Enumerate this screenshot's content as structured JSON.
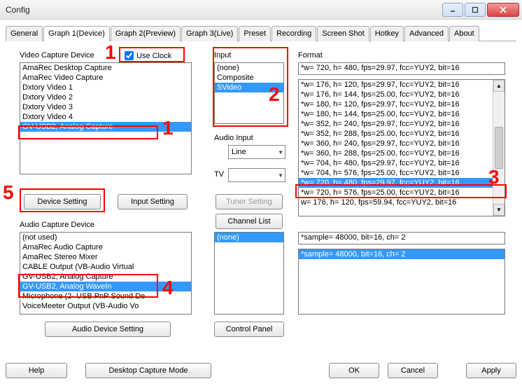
{
  "window": {
    "title": "Config"
  },
  "tabs": [
    "General",
    "Graph 1(Device)",
    "Graph 2(Preview)",
    "Graph 3(Live)",
    "Preset",
    "Recording",
    "Screen Shot",
    "Hotkey",
    "Advanced",
    "About"
  ],
  "active_tab_index": 1,
  "use_clock_label": "Use Clock",
  "use_clock_checked": true,
  "groups": {
    "video_capture": "Video Capture Device",
    "input": "Input",
    "audio_input": "Audio Input",
    "tv": "TV",
    "format": "Format",
    "audio_capture": "Audio Capture Device"
  },
  "video_devices": [
    "AmaRec Desktop Capture",
    "AmaRec Video Capture",
    "Dxtory Video 1",
    "Dxtory Video 2",
    "Dxtory Video 3",
    "Dxtory Video 4",
    "GV-USB2, Analog Capture"
  ],
  "video_devices_selected_index": 6,
  "inputs": [
    "(none)",
    "Composite",
    "SVideo"
  ],
  "inputs_selected_index": 2,
  "audio_input_value": "Line",
  "tv_value": "",
  "format_default": "*w= 720, h= 480, fps=29.97,  fcc=YUY2, bit=16",
  "formats": [
    "*w= 176, h= 120, fps=29.97,  fcc=YUY2, bit=16",
    "*w= 176, h= 144, fps=25.00,  fcc=YUY2, bit=16",
    "*w= 180, h= 120, fps=29.97,  fcc=YUY2, bit=16",
    "*w= 180, h= 144, fps=25.00,  fcc=YUY2, bit=16",
    "*w= 352, h= 240, fps=29.97,  fcc=YUY2, bit=16",
    "*w= 352, h= 288, fps=25.00,  fcc=YUY2, bit=16",
    "*w= 360, h= 240, fps=29.97,  fcc=YUY2, bit=16",
    "*w= 360, h= 288, fps=25.00,  fcc=YUY2, bit=16",
    "*w= 704, h= 480, fps=29.97,  fcc=YUY2, bit=16",
    "*w= 704, h= 576, fps=25.00,  fcc=YUY2, bit=16",
    "*w= 720, h= 480, fps=29.97,  fcc=YUY2, bit=16",
    "*w= 720, h= 576, fps=25.00,  fcc=YUY2, bit=16",
    " w= 176, h= 120, fps=59.94,  fcc=YUY2, bit=16"
  ],
  "formats_selected_index": 10,
  "audio_devices": [
    "(not used)",
    "AmaRec Audio Capture",
    "AmaRec Stereo Mixer",
    "CABLE Output (VB-Audio Virtual",
    "GV-USB2, Analog Capture",
    "GV-USB2, Analog WaveIn",
    "Microphone (2- USB PnP Sound De",
    "VoiceMeeter Output (VB-Audio Vo"
  ],
  "audio_devices_selected_index": 5,
  "audio_inputs2": [
    "(none)"
  ],
  "sample_default": "*sample= 48000, bit=16, ch= 2",
  "samples": [
    "*sample= 48000, bit=16, ch= 2"
  ],
  "samples_selected_index": 0,
  "buttons": {
    "device_setting": "Device Setting",
    "input_setting": "Input Setting",
    "tuner_setting": "Tuner Setting",
    "channel_list": "Channel List",
    "audio_device_setting": "Audio Device Setting",
    "control_panel": "Control Panel",
    "help": "Help",
    "desktop_capture_mode": "Desktop Capture Mode",
    "ok": "OK",
    "cancel": "Cancel",
    "apply": "Apply"
  },
  "annotations": [
    "1",
    "2",
    "3",
    "4",
    "5"
  ]
}
